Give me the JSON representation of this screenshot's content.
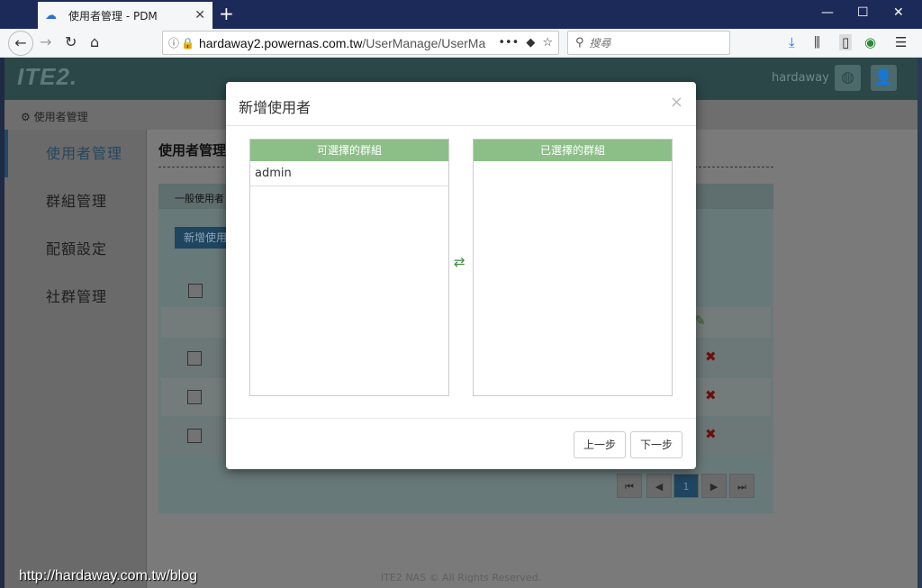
{
  "browser": {
    "tab_title": "使用者管理 - PDM",
    "url_host": "hardaway2.powernas.com.tw",
    "url_path": "/UserManage/UserMa",
    "search_placeholder": "搜尋",
    "more_label": "•••"
  },
  "app": {
    "logo": "ITE2.",
    "username": "hardaway",
    "breadcrumb": "使用者管理",
    "sidebar": [
      {
        "label": "使用者管理",
        "active": true
      },
      {
        "label": "群組管理",
        "active": false
      },
      {
        "label": "配額設定",
        "active": false
      },
      {
        "label": "社群管理",
        "active": false
      }
    ],
    "content_title": "使用者管理",
    "panel_label": "一般使用者",
    "add_button": "新增使用",
    "current_page": "1",
    "footer": "ITE2 NAS © All Rights Reserved."
  },
  "modal": {
    "title": "新增使用者",
    "close": "×",
    "available_header": "可選擇的群組",
    "selected_header": "已選擇的群組",
    "available_items": [
      "admin"
    ],
    "selected_items": [],
    "prev_button": "上一步",
    "next_button": "下一步"
  },
  "watermark": "http://hardaway.com.tw/blog"
}
